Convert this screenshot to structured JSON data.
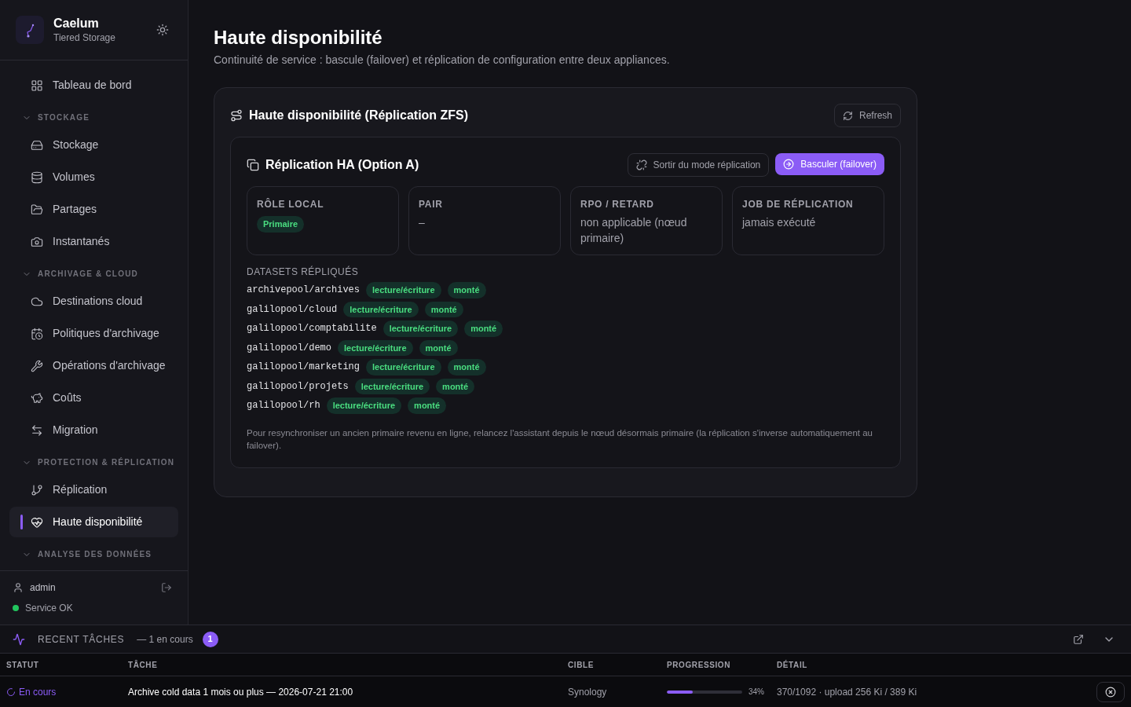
{
  "sidebar": {
    "brand": {
      "name": "Caelum",
      "subtitle": "Tiered Storage"
    },
    "nav": [
      {
        "kind": "item",
        "label": "Tableau de bord",
        "selected": false
      },
      {
        "kind": "section",
        "label": "STOCKAGE",
        "expanded": true
      },
      {
        "kind": "item",
        "label": "Stockage",
        "selected": false
      },
      {
        "kind": "item",
        "label": "Volumes",
        "selected": false
      },
      {
        "kind": "item",
        "label": "Partages",
        "selected": false
      },
      {
        "kind": "item",
        "label": "Instantanés",
        "selected": false
      },
      {
        "kind": "section",
        "label": "ARCHIVAGE & CLOUD",
        "expanded": true
      },
      {
        "kind": "item",
        "label": "Destinations cloud",
        "selected": false
      },
      {
        "kind": "item",
        "label": "Politiques d'archivage",
        "selected": false
      },
      {
        "kind": "item",
        "label": "Opérations d'archivage",
        "selected": false
      },
      {
        "kind": "item",
        "label": "Coûts",
        "selected": false
      },
      {
        "kind": "item",
        "label": "Migration",
        "selected": false
      },
      {
        "kind": "section",
        "label": "PROTECTION & RÉPLICATION",
        "expanded": true
      },
      {
        "kind": "item",
        "label": "Réplication",
        "selected": false
      },
      {
        "kind": "item",
        "label": "Haute disponibilité",
        "selected": true
      },
      {
        "kind": "section",
        "label": "ANALYSE DES DONNÉES",
        "expanded": true
      }
    ],
    "user": "admin",
    "status": {
      "label": "Service OK",
      "color": "#22c55e"
    }
  },
  "page": {
    "title": "Haute disponibilité",
    "subtitle": "Continuité de service : bascule (failover) et réplication de configuration entre deux appliances."
  },
  "panel": {
    "title": "Haute disponibilité (Réplication ZFS)",
    "refresh_button": "Refresh",
    "replication": {
      "title": "Réplication HA (Option A)",
      "buttons": [
        {
          "label": "Sortir du mode réplication",
          "kind": "secondary"
        },
        {
          "label": "Basculer (failover)",
          "kind": "primary"
        }
      ],
      "stats": [
        {
          "label": "RÔLE LOCAL",
          "badge": "Primaire"
        },
        {
          "label": "PAIR",
          "value": "–"
        },
        {
          "label": "RPO / RETARD",
          "value": "non applicable (nœud primaire)"
        },
        {
          "label": "JOB DE RÉPLICATION",
          "value": "jamais exécuté"
        }
      ],
      "datasets_heading": "DATASETS RÉPLIQUÉS",
      "datasets": [
        {
          "name": "archivepool/archives",
          "tags": [
            "lecture/écriture",
            "monté"
          ]
        },
        {
          "name": "galilopool/cloud",
          "tags": [
            "lecture/écriture",
            "monté"
          ]
        },
        {
          "name": "galilopool/comptabilite",
          "tags": [
            "lecture/écriture",
            "monté"
          ]
        },
        {
          "name": "galilopool/demo",
          "tags": [
            "lecture/écriture",
            "monté"
          ]
        },
        {
          "name": "galilopool/marketing",
          "tags": [
            "lecture/écriture",
            "monté"
          ]
        },
        {
          "name": "galilopool/projets",
          "tags": [
            "lecture/écriture",
            "monté"
          ]
        },
        {
          "name": "galilopool/rh",
          "tags": [
            "lecture/écriture",
            "monté"
          ]
        }
      ],
      "note": "Pour resynchroniser un ancien primaire revenu en ligne, relancez l'assistant depuis le nœud désormais primaire (la réplication s'inverse automatiquement au failover)."
    }
  },
  "tasks": {
    "title": "RECENT TÂCHES",
    "summary": "— 1 en cours",
    "count": "1",
    "columns": [
      "STATUT",
      "TÂCHE",
      "CIBLE",
      "PROGRESSION",
      "DÉTAIL"
    ],
    "rows": [
      {
        "status": "En cours",
        "task": "Archive cold data 1 mois ou plus — 2026-07-21 21:00",
        "target": "Synology",
        "level": 0.34,
        "percent": "34%",
        "detail": "370/1092 · upload 256 Ki / 389 Ki"
      }
    ]
  }
}
